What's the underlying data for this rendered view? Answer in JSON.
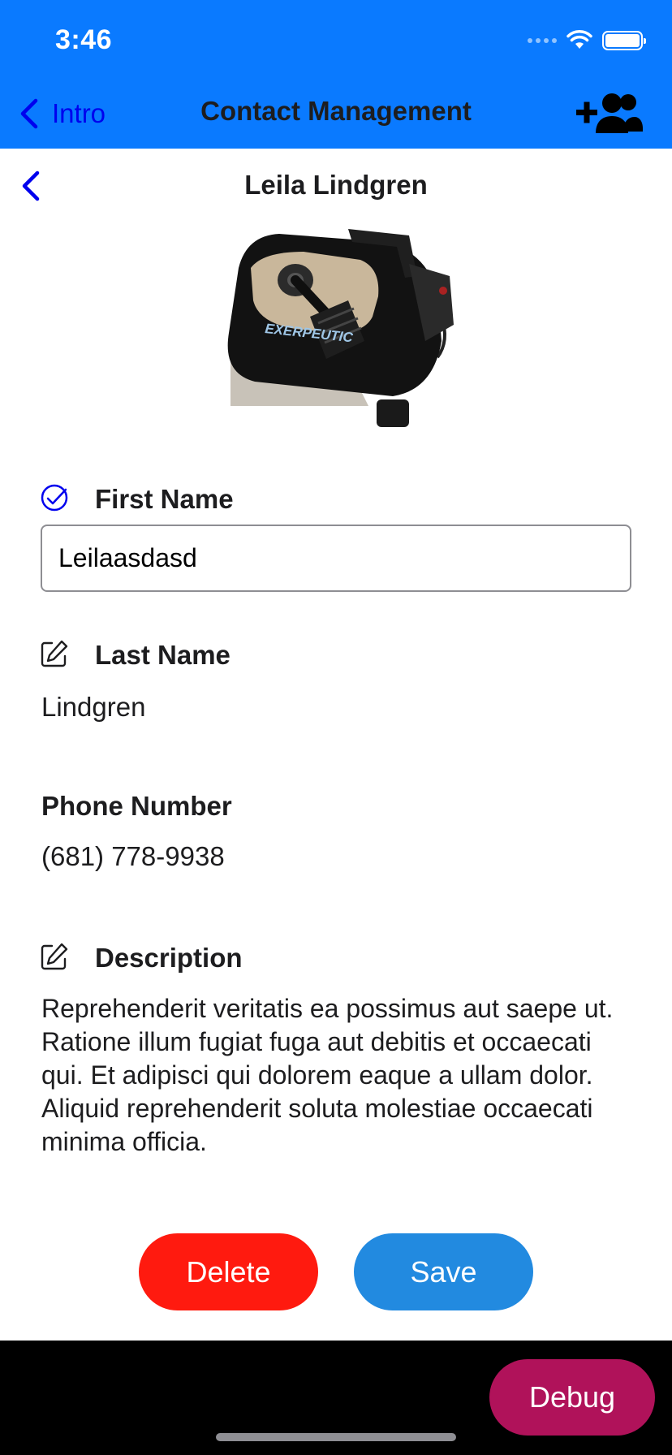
{
  "status_bar": {
    "time": "3:46"
  },
  "nav": {
    "back_label": "Intro",
    "title": "Contact Management",
    "add_icon": "person-add-icon"
  },
  "contact": {
    "title": "Leila Lindgren",
    "image_brand_text": "EXERPEUTIC",
    "first_name": {
      "label": "First Name",
      "value": "Leilaasdasd",
      "status": "editing"
    },
    "last_name": {
      "label": "Last Name",
      "value": "Lindgren"
    },
    "phone": {
      "label": "Phone Number",
      "value": "(681) 778-9938"
    },
    "description": {
      "label": "Description",
      "value": "Reprehenderit veritatis ea possimus aut saepe ut. Ratione illum fugiat fuga aut debitis et occaecati qui. Et adipisci qui dolorem eaque a ullam dolor. Aliquid reprehenderit soluta molestiae occaecati minima officia."
    }
  },
  "actions": {
    "delete_label": "Delete",
    "save_label": "Save"
  },
  "debug": {
    "label": "Debug"
  },
  "colors": {
    "nav_bar": "#0a7aff",
    "link": "#0000ee",
    "delete": "#ff1a0f",
    "save": "#228ae0",
    "debug": "#b0125a"
  }
}
